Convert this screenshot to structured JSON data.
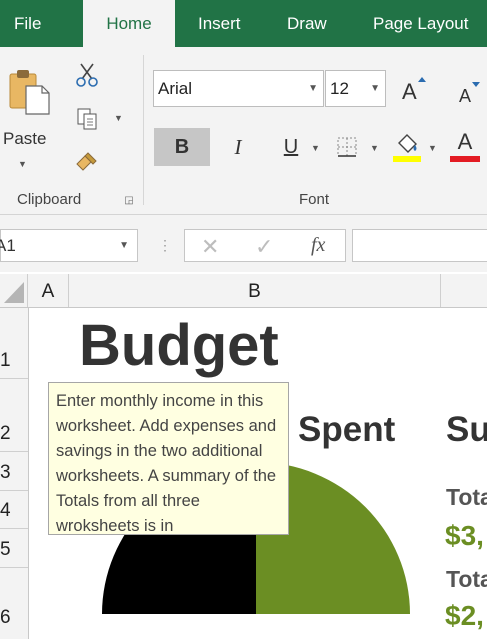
{
  "ribbon_tabs": [
    {
      "label": "File",
      "active": false
    },
    {
      "label": "Home",
      "active": true
    },
    {
      "label": "Insert",
      "active": false
    },
    {
      "label": "Draw",
      "active": false
    },
    {
      "label": "Page Layout",
      "active": false
    }
  ],
  "clipboard": {
    "paste_label": "Paste",
    "group_label": "Clipboard"
  },
  "font": {
    "font_name": "Arial",
    "font_size": "12",
    "bold_label": "B",
    "italic_label": "I",
    "underline_label": "U",
    "font_color_label": "A",
    "group_label": "Font",
    "highlight_color": "#ffff00",
    "font_color": "#e31b23"
  },
  "formula_bar": {
    "name_box": "A1",
    "fx_label": "fx",
    "formula": ""
  },
  "columns": [
    "A",
    "B"
  ],
  "rows": [
    "1",
    "2",
    "3",
    "4",
    "5",
    "6"
  ],
  "sheet": {
    "title": "Budget",
    "spent_label": "Spent",
    "summary_label": "Su",
    "totals_label_1": "Tota",
    "totals_value_1": "$3,",
    "totals_label_2": "Tota",
    "totals_value_2": "$2,",
    "accent_color": "#6b8e23"
  },
  "tooltip": {
    "text": "Enter monthly income in this worksheet. Add expenses and savings in the two additional  worksheets. A summary of the Totals from all three wroksheets is in"
  }
}
